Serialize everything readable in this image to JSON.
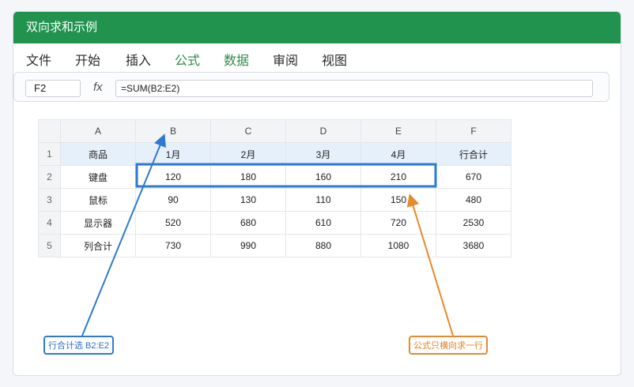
{
  "window": {
    "title": "双向求和示例"
  },
  "menu": {
    "file": "文件",
    "home": "开始",
    "insert": "插入",
    "formula": "公式",
    "data": "数据",
    "review": "审阅",
    "view": "视图"
  },
  "formula_bar": {
    "cell_ref": "F2",
    "fx": "fx",
    "formula": "=SUM(B2:E2)"
  },
  "sheet": {
    "columns": [
      "A",
      "B",
      "C",
      "D",
      "E",
      "F"
    ],
    "rows": [
      {
        "num": "1",
        "cells": [
          "商品",
          "1月",
          "2月",
          "3月",
          "4月",
          "行合计"
        ]
      },
      {
        "num": "2",
        "cells": [
          "键盘",
          "120",
          "180",
          "160",
          "210",
          "670"
        ]
      },
      {
        "num": "3",
        "cells": [
          "鼠标",
          "90",
          "130",
          "110",
          "150",
          "480"
        ]
      },
      {
        "num": "4",
        "cells": [
          "显示器",
          "520",
          "680",
          "610",
          "720",
          "2530"
        ]
      },
      {
        "num": "5",
        "cells": [
          "列合计",
          "730",
          "990",
          "880",
          "1080",
          "3680"
        ]
      }
    ]
  },
  "annotations": {
    "row_sum_label": "行合计选 B2:E2",
    "formula_note": "公式只横向求一行"
  },
  "colors": {
    "titlebar": "#21934f",
    "highlight_blue": "#2e7ad0",
    "highlight_orange": "#e8892a",
    "header_row": "#e6f0fb"
  }
}
